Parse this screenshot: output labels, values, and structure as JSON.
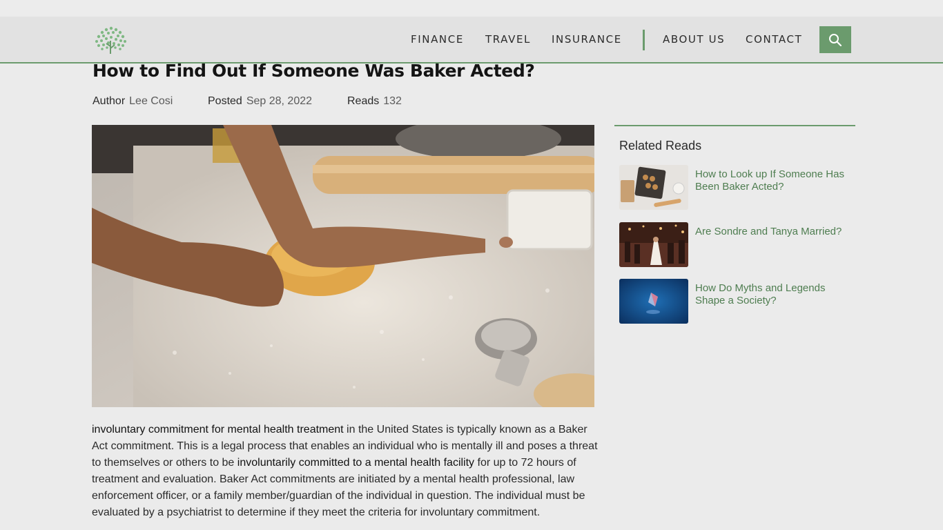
{
  "nav": {
    "items": [
      "FINANCE",
      "TRAVEL",
      "INSURANCE",
      "ABOUT US",
      "CONTACT"
    ]
  },
  "article": {
    "title": "How to Find Out If Someone Was Baker Acted?",
    "meta": {
      "author_label": "Author",
      "author": "Lee Cosi",
      "posted_label": "Posted",
      "posted": "Sep 28, 2022",
      "reads_label": "Reads",
      "reads": "132"
    },
    "body": [
      {
        "b": true,
        "t": "involuntary commitment for mental health treatment"
      },
      {
        "b": false,
        "t": " in the United States is typically known as a Baker Act commitment. This is a legal process that enables an individual who is mentally ill and poses a threat to themselves or others to be "
      },
      {
        "b": true,
        "t": "involuntarily committed to a mental health facility"
      },
      {
        "b": false,
        "t": " for up to 72 hours of treatment and evaluation. Baker Act commitments are initiated by a mental health professional, law enforcement officer, or a family member/guardian of the individual in question. The individual must be evaluated by a psychiatrist to determine if they meet the criteria for involuntary commitment."
      }
    ]
  },
  "sidebar": {
    "title": "Related Reads",
    "items": [
      {
        "label": "How to Look up If Someone Has Been Baker Acted?"
      },
      {
        "label": "Are Sondre and Tanya Married?"
      },
      {
        "label": "How Do Myths and Legends Shape a Society?"
      }
    ]
  },
  "colors": {
    "accent": "#6b9b6d",
    "link": "#4e7d50",
    "background": "#ebebeb"
  },
  "icons": {
    "logo": "tree-logo-icon",
    "search": "search-icon"
  }
}
